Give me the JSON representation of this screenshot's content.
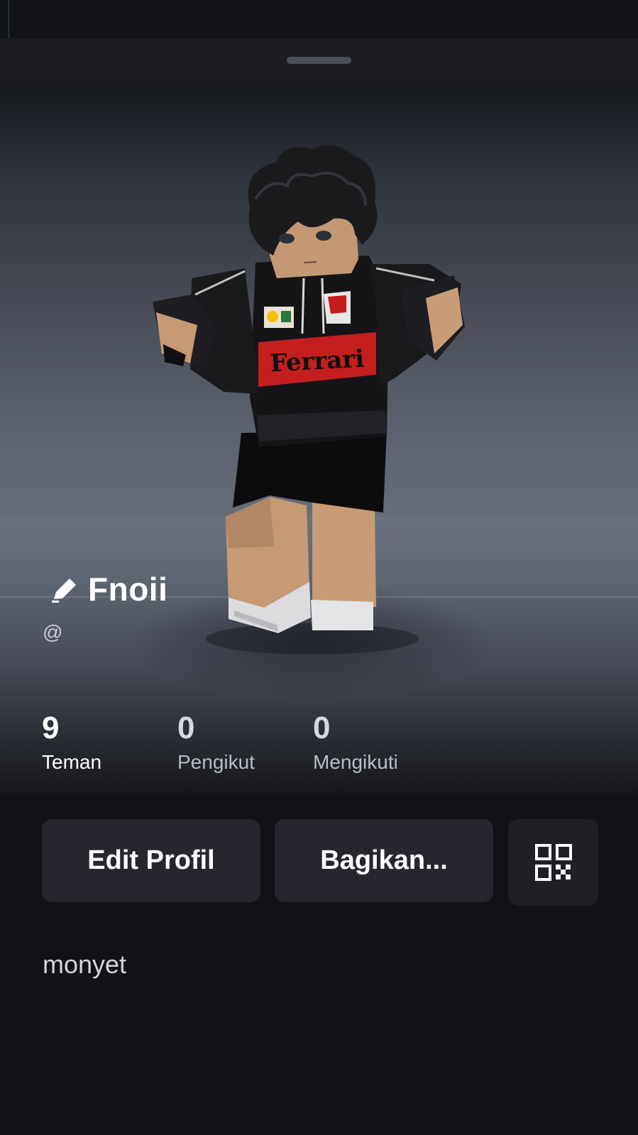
{
  "profile": {
    "display_name": "Fnoii",
    "username": "@",
    "bio": "monyet"
  },
  "stats": [
    {
      "value": "9",
      "label": "Teman"
    },
    {
      "value": "0",
      "label": "Pengikut"
    },
    {
      "value": "0",
      "label": "Mengikuti"
    }
  ],
  "actions": {
    "edit_label": "Edit Profil",
    "share_label": "Bagikan..."
  },
  "icons": {
    "edit": "pencil-icon",
    "qr": "qr-code-icon"
  },
  "colors": {
    "background": "#121317",
    "button": "#26272e",
    "text": "#ffffff"
  }
}
